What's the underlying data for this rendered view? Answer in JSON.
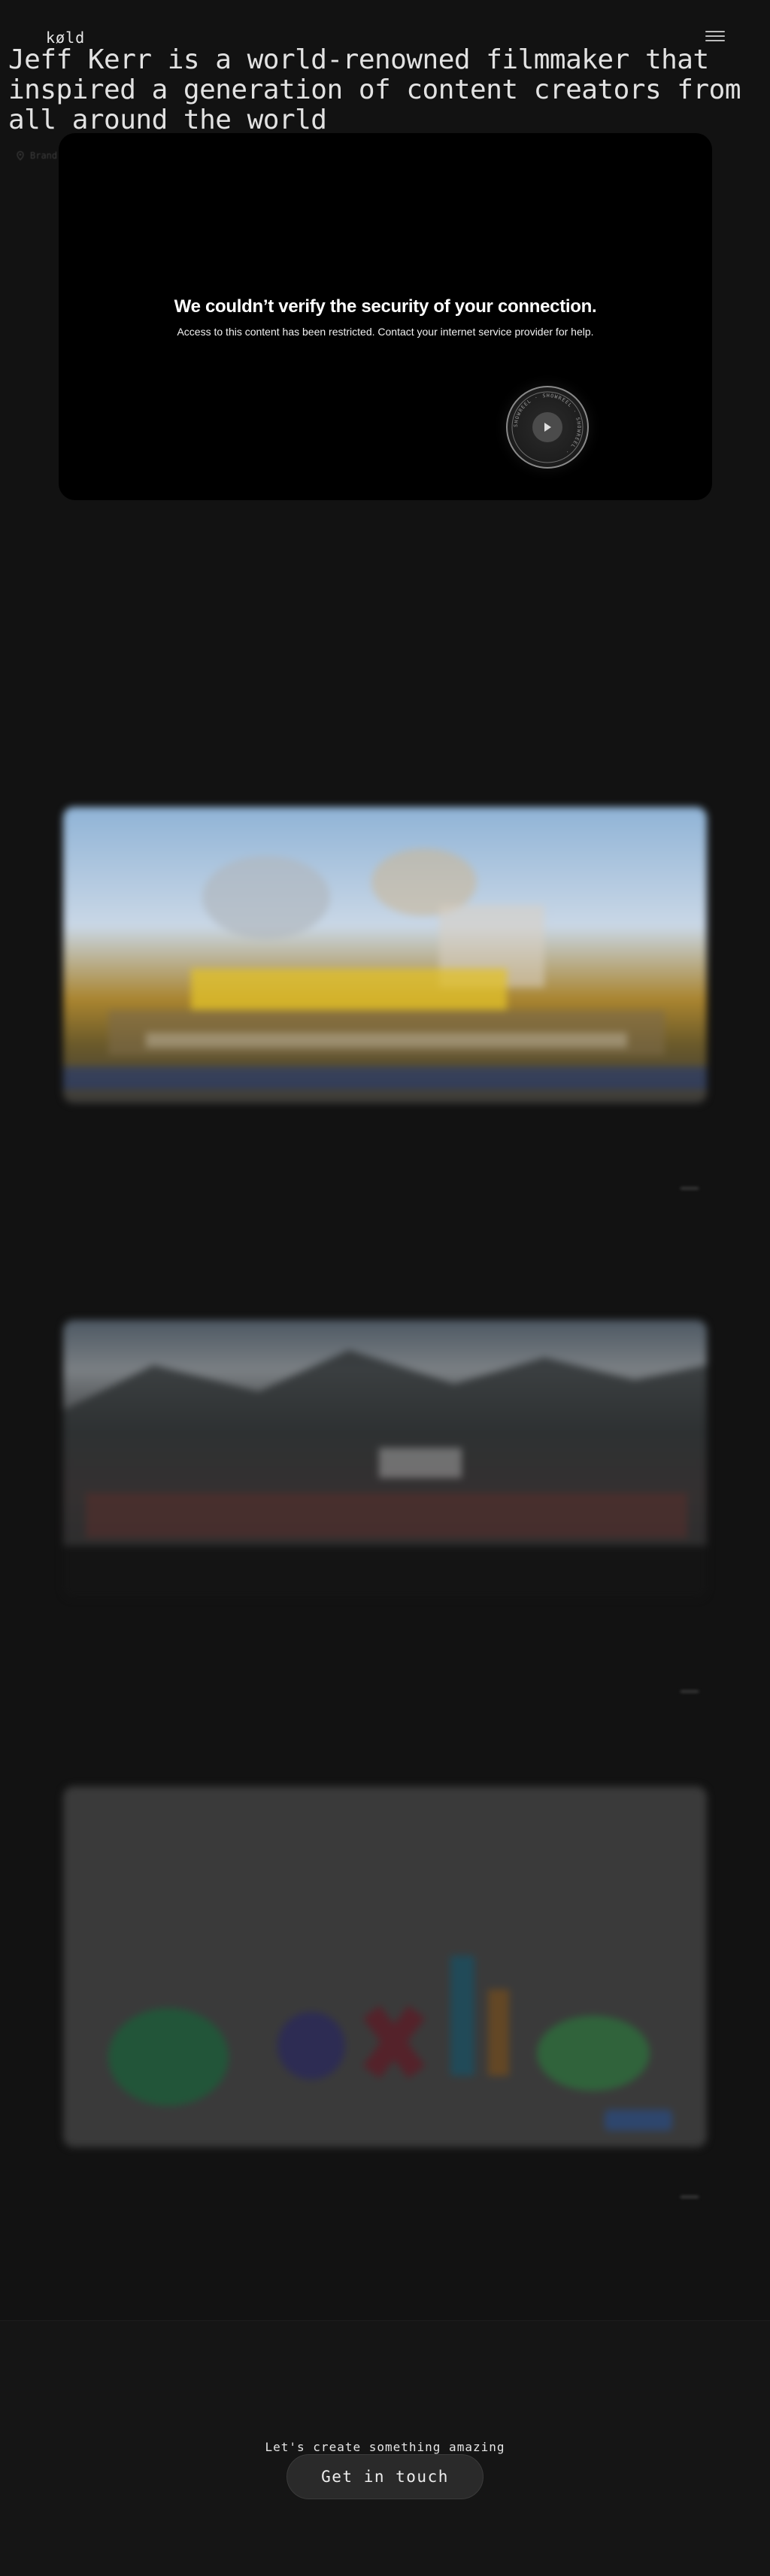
{
  "header": {
    "logo": "køld",
    "menu_icon": "hamburger-menu-icon"
  },
  "hero": {
    "title": "Jeff Kerr is a world-renowned filmmaker that inspired a generation of content creators from all around the world",
    "tag": "Brand",
    "tag_icon": "map-pin-icon"
  },
  "video": {
    "error_title": "We couldn’t verify the security of your connection.",
    "error_message": "Access to this content has been restricted. Contact your internet service provider for help.",
    "play_icon": "play-icon",
    "badge_text": "SHOWREEL · SHOWREEL · SHOWREEL ·"
  },
  "projects": [
    {
      "title": "",
      "subtitle": "",
      "image_desc_icon": "project-thumbnail"
    },
    {
      "title": "",
      "subtitle": "",
      "image_desc_icon": "project-thumbnail"
    },
    {
      "title": "",
      "subtitle": "",
      "image_desc_icon": "project-thumbnail"
    }
  ],
  "footer": {
    "cta_text": "Let's create something amazing",
    "cta_button": "Get in touch"
  },
  "colors": {
    "background": "#121212",
    "video_bg": "#000000",
    "button_bg": "#2a2a2a"
  }
}
